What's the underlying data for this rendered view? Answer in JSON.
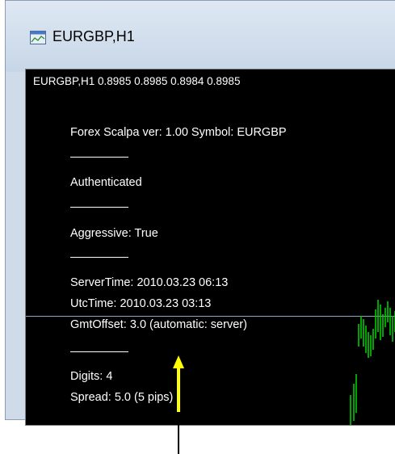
{
  "window": {
    "title": "EURGBP,H1",
    "icon": "chart-window-icon"
  },
  "chart": {
    "header": "EURGBP,H1  0.8985 0.8985 0.8984 0.8985",
    "lines": [
      "Forex Scalpa ver: 1.00 Symbol: EURGBP",
      "Authenticated",
      "Aggressive:  True",
      "ServerTime:  2010.03.23 06:13",
      "UtcTime:  2010.03.23 03:13",
      "GmtOffset:   3.0 (automatic: server)",
      "Digits:  4",
      "Spread:  5.0 (5 pips)"
    ],
    "colors": {
      "background": "#000000",
      "text": "#ffffff",
      "candles": "#00cc00",
      "arrow": "#ffff00"
    }
  }
}
